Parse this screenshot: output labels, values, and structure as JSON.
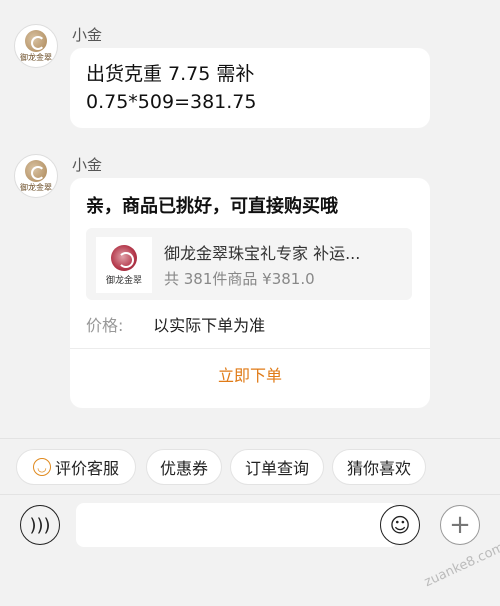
{
  "messages": [
    {
      "sender": "小金",
      "avatar_brand": "御龙金翠",
      "lines": [
        "出货克重 7.75   需补",
        "0.75*509=381.75"
      ]
    },
    {
      "sender": "小金",
      "avatar_brand": "御龙金翠",
      "card": {
        "title": "亲，商品已挑好，可直接购买哦",
        "product_name": "御龙金翠珠宝礼专家 补运...",
        "product_info": "共 381件商品  ¥381.0",
        "thumb_brand": "御龙金翠",
        "price_label": "价格:",
        "price_value": "以实际下单为准",
        "order_button": "立即下单"
      }
    }
  ],
  "quick_actions": [
    "评价客服",
    "优惠券",
    "订单查询",
    "猜你喜欢"
  ],
  "input": {
    "placeholder": ""
  },
  "icons": {
    "voice": "voice-icon",
    "emoji": "emoji-icon",
    "plus": "plus-icon",
    "rate": "smile-icon"
  },
  "watermark": "zuanke8.com",
  "colors": {
    "accent": "#e07b17",
    "background": "#f2f2f2",
    "bubble": "#ffffff"
  }
}
